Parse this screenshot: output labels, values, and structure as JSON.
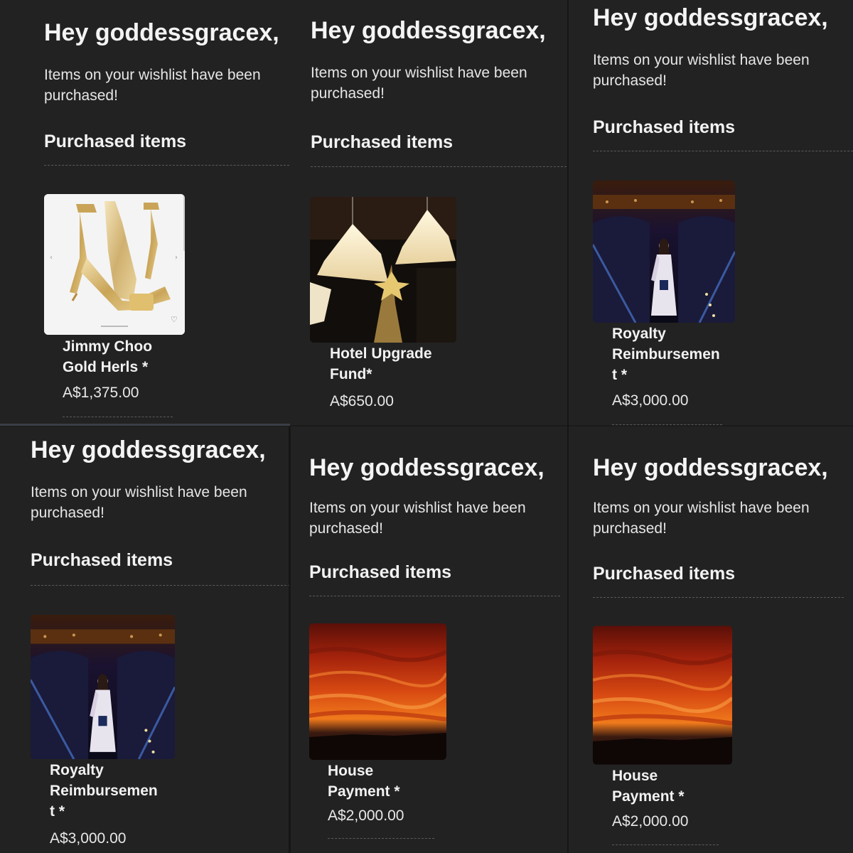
{
  "greeting": "Hey goddessgracex,",
  "message": "Items on your wishlist have been purchased!",
  "section_title": "Purchased items",
  "panels": [
    {
      "item_name": "Jimmy Choo\nGold Herls *",
      "price": "A$1,375.00",
      "image": "gold-sandal-image"
    },
    {
      "item_name": "Hotel Upgrade\nFund*",
      "price": "A$650.00",
      "image": "hotel-lamps-image"
    },
    {
      "item_name": "Royalty\nReimbursemen\nt *",
      "price": "A$3,000.00",
      "image": "woman-on-staircase-image"
    },
    {
      "item_name": "Royalty\nReimbursemen\nt *",
      "price": "A$3,000.00",
      "image": "woman-on-staircase-image"
    },
    {
      "item_name": "House\nPayment *",
      "price": "A$2,000.00",
      "image": "red-sunset-image"
    },
    {
      "item_name": "House\nPayment *",
      "price": "A$2,000.00",
      "image": "red-sunset-image"
    }
  ]
}
